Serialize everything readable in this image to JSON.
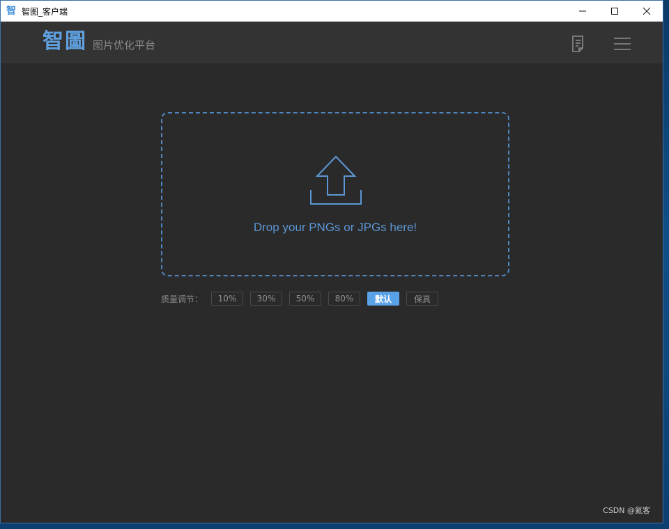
{
  "window": {
    "title": "智图_客户端",
    "app_icon": "智",
    "controls": [
      "minimize-icon",
      "maximize-icon",
      "close-icon"
    ]
  },
  "header": {
    "logo": "智圖",
    "subtitle": "图片优化平台",
    "icons": [
      "document-icon",
      "hamburger-menu-icon"
    ]
  },
  "dropzone": {
    "icon": "upload-arrow-icon",
    "text": "Drop your PNGs or JPGs here!"
  },
  "quality": {
    "label": "质量调节：",
    "options": [
      "10%",
      "30%",
      "50%",
      "80%",
      "默认",
      "保真"
    ],
    "selected": "默认"
  },
  "watermark": "CSDN @氦客",
  "colors": {
    "accent": "#5aa2e8",
    "background": "#2a2a2a",
    "header": "#333333",
    "dashed_border": "#4f86be"
  }
}
